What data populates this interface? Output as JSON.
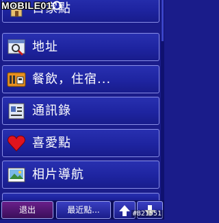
{
  "watermark": "MOBILE01",
  "menu": {
    "items": [
      {
        "label": "目家點",
        "icon": "home-icon"
      },
      {
        "label": "地址",
        "icon": "address-search-icon"
      },
      {
        "label": "餐飲，住宿...",
        "icon": "food-lodging-icon"
      },
      {
        "label": "通訊錄",
        "icon": "contacts-icon"
      },
      {
        "label": "喜愛點",
        "icon": "heart-icon"
      },
      {
        "label": "相片導航",
        "icon": "photo-icon"
      }
    ]
  },
  "footer": {
    "exit_label": "退出",
    "recent_label": "最近點...",
    "up_icon": "arrow-up-icon",
    "down_icon": "arrow-down-icon"
  },
  "image_tag": "#821551",
  "colors": {
    "background": "#1a1c8a",
    "item_border": "#8a8fe8",
    "exit_button": "#6a1f8a",
    "heart": "#e0141e"
  }
}
